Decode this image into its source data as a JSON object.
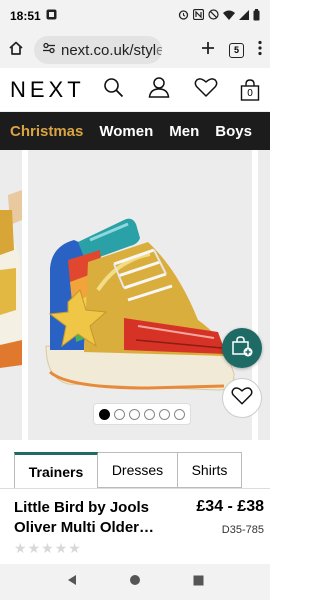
{
  "status_bar": {
    "time": "18:51"
  },
  "browser": {
    "url": "next.co.uk/styl",
    "url_faded_tail": "e",
    "tab_count": "5"
  },
  "header": {
    "logo": "NEXT",
    "bag_count": "0"
  },
  "categories": [
    {
      "label": "Christmas",
      "active": true
    },
    {
      "label": "Women",
      "active": false
    },
    {
      "label": "Men",
      "active": false
    },
    {
      "label": "Boys",
      "active": false
    }
  ],
  "carousel": {
    "total_slides": 6,
    "active_index": 0
  },
  "tabs": [
    {
      "label": "Trainers"
    },
    {
      "label": "Dresses"
    },
    {
      "label": "Shirts"
    }
  ],
  "product": {
    "title": "Little Bird by Jools Oliver Multi Older…",
    "price": "£34 - £38",
    "code": "D35-785",
    "rating_stars": 5
  },
  "colors": {
    "accent_teal": "#1e6b66",
    "nav_bg": "#1c1c1c",
    "christmas_gold": "#d9a441"
  }
}
